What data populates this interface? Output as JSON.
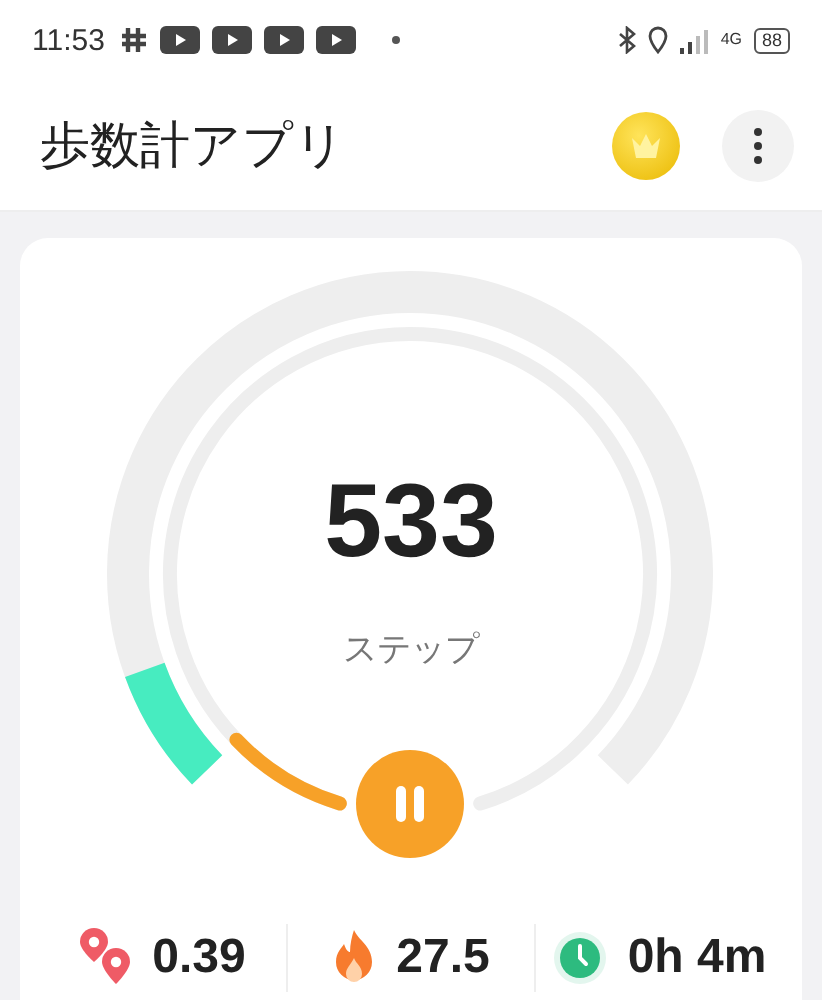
{
  "status_bar": {
    "time": "11:53",
    "network": "4G",
    "battery": "88"
  },
  "header": {
    "title": "歩数計アプリ"
  },
  "steps": {
    "count": "533",
    "unit": "ステップ",
    "paused": false
  },
  "stats": [
    {
      "kind": "distance",
      "value": "0.39"
    },
    {
      "kind": "calories",
      "value": "27.5"
    },
    {
      "kind": "time",
      "value": "0h 4m"
    }
  ]
}
